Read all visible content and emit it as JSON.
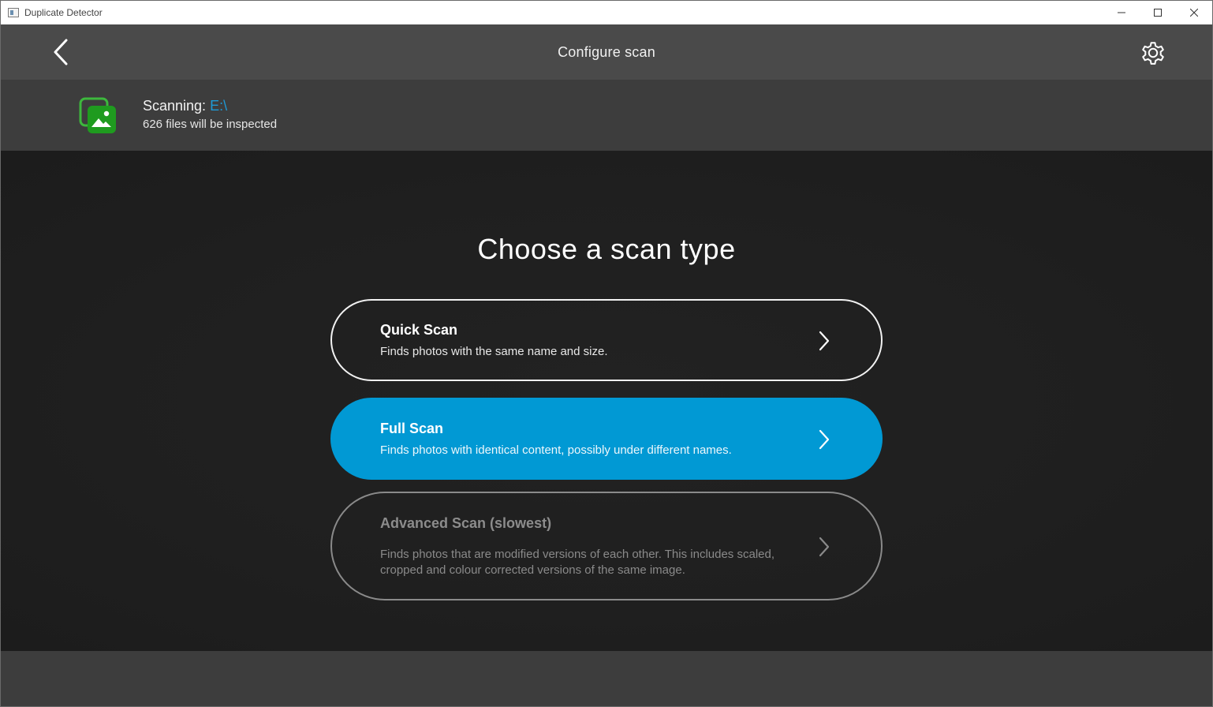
{
  "window": {
    "title": "Duplicate Detector"
  },
  "header": {
    "title": "Configure scan"
  },
  "scan_info": {
    "scanning_label": "Scanning:",
    "scanning_path": "E:\\",
    "files_text": "626 files will be inspected"
  },
  "main": {
    "heading": "Choose a scan type",
    "options": [
      {
        "title": "Quick Scan",
        "description": "Finds photos with the same name and size."
      },
      {
        "title": "Full Scan",
        "description": "Finds photos with identical content, possibly under different names."
      },
      {
        "title": "Advanced Scan (slowest)",
        "description": "Finds photos that are modified versions of each other. This includes scaled, cropped and colour corrected versions of the same image."
      }
    ]
  },
  "colors": {
    "accent": "#0199d4",
    "header_bg": "#4a4a4a",
    "info_bg": "#3d3d3d",
    "main_bg": "#1e1e1e",
    "icon_green": "#2aa02a"
  },
  "icons": {
    "back": "chevron-left-icon",
    "settings": "gear-icon",
    "app": "photo-stack-icon",
    "option": "chevron-right-icon"
  }
}
